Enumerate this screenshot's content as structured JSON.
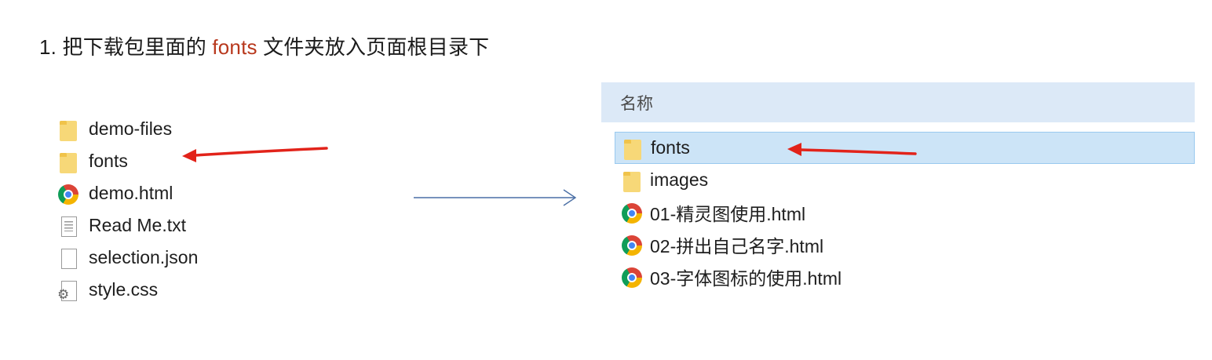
{
  "instruction": {
    "prefix": "1. 把下载包里面的 ",
    "highlight": "fonts",
    "suffix": " 文件夹放入页面根目录下"
  },
  "download_package": {
    "items": [
      {
        "name": "demo-files",
        "icon": "folder-icon"
      },
      {
        "name": "fonts",
        "icon": "folder-icon"
      },
      {
        "name": "demo.html",
        "icon": "chrome-icon"
      },
      {
        "name": "Read Me.txt",
        "icon": "text-file-icon"
      },
      {
        "name": "selection.json",
        "icon": "file-icon"
      },
      {
        "name": "style.css",
        "icon": "css-file-icon"
      }
    ]
  },
  "explorer": {
    "column_header": "名称",
    "items": [
      {
        "name": "fonts",
        "icon": "folder-icon",
        "selected": true
      },
      {
        "name": "images",
        "icon": "folder-icon"
      },
      {
        "name": "01-精灵图使用.html",
        "icon": "chrome-icon"
      },
      {
        "name": "02-拼出自己名字.html",
        "icon": "chrome-icon"
      },
      {
        "name": "03-字体图标的使用.html",
        "icon": "chrome-icon"
      }
    ]
  },
  "colors": {
    "highlight_text": "#b8381d",
    "annotation_arrow": "#e2231a",
    "flow_arrow": "#4a6fa5",
    "selection_bg": "#cce4f7",
    "header_bg": "#dce9f7"
  }
}
